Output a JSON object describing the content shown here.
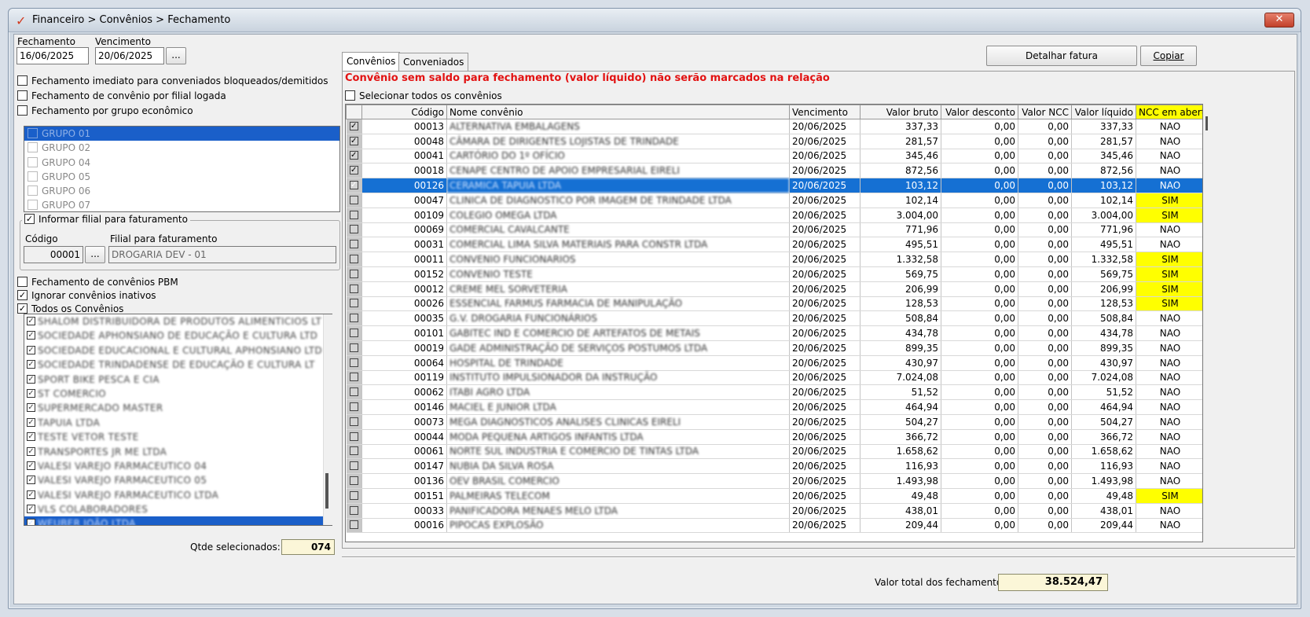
{
  "window": {
    "title": "Financeiro > Convênios > Fechamento",
    "close_label": "✕",
    "app_icon": "checkmark-logo-icon"
  },
  "left": {
    "fechamento_label": "Fechamento",
    "fechamento_value": "16/06/2025",
    "vencimento_label": "Vencimento",
    "vencimento_value": "20/06/2025",
    "date_btn": "...",
    "opt_imediato": "Fechamento imediato para conveniados bloqueados/demitidos",
    "opt_filial": "Fechamento de convênio por filial logada",
    "opt_grupo": "Fechamento por grupo econômico",
    "grupos": [
      "GRUPO 01",
      "GRUPO 02",
      "GRUPO 04",
      "GRUPO 05",
      "GRUPO 06",
      "GRUPO 07"
    ],
    "informar_filial": "Informar filial para faturamento",
    "codigo_label": "Código",
    "codigo_value": "00001",
    "filial_btn": "...",
    "filial_label": "Filial para faturamento",
    "filial_value": "DROGARIA DEV - 01",
    "opt_pbm": "Fechamento de convênios PBM",
    "opt_inativos": "Ignorar convênios inativos",
    "opt_todos": "Todos os Convênios",
    "convenios": [
      "SHALOM DISTRIBUIDORA DE PRODUTOS ALIMENTICIOS LT",
      "SOCIEDADE APHONSIANO DE EDUCAÇÃO E CULTURA LTD",
      "SOCIEDADE EDUCACIONAL E CULTURAL APHONSIANO LTD",
      "SOCIEDADE TRINDADENSE DE EDUCAÇÃO E CULTURA LT",
      "SPORT BIKE PESCA E CIA",
      "ST COMERCIO",
      "SUPERMERCADO MASTER",
      "TAPUIA LTDA",
      "TESTE VETOR TESTE",
      "TRANSPORTES JR ME LTDA",
      "VALESI VAREJO FARMACEUTICO 04",
      "VALESI VAREJO FARMACEUTICO 05",
      "VALESI VAREJO FARMACEUTICO LTDA",
      "VLS COLABORADORES",
      "WEUBER JOÃO LTDA"
    ],
    "qtde_label": "Qtde selecionados:",
    "qtde_value": "074"
  },
  "tabs": [
    "Convênios",
    "Conveniados"
  ],
  "toolbar": {
    "detalhar": "Detalhar fatura",
    "copiar": "Copiar"
  },
  "warning": "Convênio sem saldo para fechamento (valor líquido) não serão marcados na relação",
  "select_all": "Selecionar todos os convênios",
  "grid": {
    "columns": [
      "Código",
      "Nome convênio",
      "Vencimento",
      "Valor bruto",
      "Valor desconto",
      "Valor NCC",
      "Valor líquido",
      "NCC em aberto"
    ],
    "rows": [
      {
        "checked": true,
        "codigo": "00013",
        "nome": "ALTERNATIVA EMBALAGENS",
        "venc": "20/06/2025",
        "bruto": "337,33",
        "desc": "0,00",
        "ncc": "0,00",
        "liq": "337,33",
        "aberto": "NAO"
      },
      {
        "checked": true,
        "codigo": "00048",
        "nome": "CÂMARA DE DIRIGENTES LOJISTAS DE TRINDADE",
        "venc": "20/06/2025",
        "bruto": "281,57",
        "desc": "0,00",
        "ncc": "0,00",
        "liq": "281,57",
        "aberto": "NAO"
      },
      {
        "checked": true,
        "codigo": "00041",
        "nome": "CARTÓRIO DO 1º OFÍCIO",
        "venc": "20/06/2025",
        "bruto": "345,46",
        "desc": "0,00",
        "ncc": "0,00",
        "liq": "345,46",
        "aberto": "NAO"
      },
      {
        "checked": true,
        "codigo": "00018",
        "nome": "CENAPE CENTRO DE APOIO EMPRESARIAL EIRELI",
        "venc": "20/06/2025",
        "bruto": "872,56",
        "desc": "0,00",
        "ncc": "0,00",
        "liq": "872,56",
        "aberto": "NAO"
      },
      {
        "checked": true,
        "codigo": "00126",
        "nome": "CERAMICA TAPUIA LTDA",
        "venc": "20/06/2025",
        "bruto": "103,12",
        "desc": "0,00",
        "ncc": "0,00",
        "liq": "103,12",
        "aberto": "NAO",
        "sel": true
      },
      {
        "checked": false,
        "codigo": "00047",
        "nome": "CLINICA DE DIAGNOSTICO POR IMAGEM DE TRINDADE LTDA",
        "venc": "20/06/2025",
        "bruto": "102,14",
        "desc": "0,00",
        "ncc": "0,00",
        "liq": "102,14",
        "aberto": "SIM"
      },
      {
        "checked": false,
        "codigo": "00109",
        "nome": "COLEGIO OMEGA LTDA",
        "venc": "20/06/2025",
        "bruto": "3.004,00",
        "desc": "0,00",
        "ncc": "0,00",
        "liq": "3.004,00",
        "aberto": "SIM"
      },
      {
        "checked": false,
        "codigo": "00069",
        "nome": "COMERCIAL CAVALCANTE",
        "venc": "20/06/2025",
        "bruto": "771,96",
        "desc": "0,00",
        "ncc": "0,00",
        "liq": "771,96",
        "aberto": "NAO"
      },
      {
        "checked": false,
        "codigo": "00031",
        "nome": "COMERCIAL LIMA SILVA MATERIAIS PARA CONSTR LTDA",
        "venc": "20/06/2025",
        "bruto": "495,51",
        "desc": "0,00",
        "ncc": "0,00",
        "liq": "495,51",
        "aberto": "NAO"
      },
      {
        "checked": false,
        "codigo": "00011",
        "nome": "CONVENIO FUNCIONARIOS",
        "venc": "20/06/2025",
        "bruto": "1.332,58",
        "desc": "0,00",
        "ncc": "0,00",
        "liq": "1.332,58",
        "aberto": "SIM"
      },
      {
        "checked": false,
        "codigo": "00152",
        "nome": "CONVENIO TESTE",
        "venc": "20/06/2025",
        "bruto": "569,75",
        "desc": "0,00",
        "ncc": "0,00",
        "liq": "569,75",
        "aberto": "SIM"
      },
      {
        "checked": false,
        "codigo": "00012",
        "nome": "CREME MEL SORVETERIA",
        "venc": "20/06/2025",
        "bruto": "206,99",
        "desc": "0,00",
        "ncc": "0,00",
        "liq": "206,99",
        "aberto": "SIM"
      },
      {
        "checked": false,
        "codigo": "00026",
        "nome": "ESSENCIAL FARMUS FARMACIA DE MANIPULAÇÃO",
        "venc": "20/06/2025",
        "bruto": "128,53",
        "desc": "0,00",
        "ncc": "0,00",
        "liq": "128,53",
        "aberto": "SIM"
      },
      {
        "checked": false,
        "codigo": "00035",
        "nome": "G.V. DROGARIA FUNCIONÁRIOS",
        "venc": "20/06/2025",
        "bruto": "508,84",
        "desc": "0,00",
        "ncc": "0,00",
        "liq": "508,84",
        "aberto": "NAO"
      },
      {
        "checked": false,
        "codigo": "00101",
        "nome": "GABITEC IND E COMERCIO DE ARTEFATOS DE METAIS",
        "venc": "20/06/2025",
        "bruto": "434,78",
        "desc": "0,00",
        "ncc": "0,00",
        "liq": "434,78",
        "aberto": "NAO"
      },
      {
        "checked": false,
        "codigo": "00019",
        "nome": "GADE ADMINISTRAÇÃO DE SERVIÇOS POSTUMOS LTDA",
        "venc": "20/06/2025",
        "bruto": "899,35",
        "desc": "0,00",
        "ncc": "0,00",
        "liq": "899,35",
        "aberto": "NAO"
      },
      {
        "checked": false,
        "codigo": "00064",
        "nome": "HOSPITAL DE TRINDADE",
        "venc": "20/06/2025",
        "bruto": "430,97",
        "desc": "0,00",
        "ncc": "0,00",
        "liq": "430,97",
        "aberto": "NAO"
      },
      {
        "checked": false,
        "codigo": "00119",
        "nome": "INSTITUTO IMPULSIONADOR DA INSTRUÇÃO",
        "venc": "20/06/2025",
        "bruto": "7.024,08",
        "desc": "0,00",
        "ncc": "0,00",
        "liq": "7.024,08",
        "aberto": "NAO"
      },
      {
        "checked": false,
        "codigo": "00062",
        "nome": "ITABI AGRO LTDA",
        "venc": "20/06/2025",
        "bruto": "51,52",
        "desc": "0,00",
        "ncc": "0,00",
        "liq": "51,52",
        "aberto": "NAO"
      },
      {
        "checked": false,
        "codigo": "00146",
        "nome": "MACIEL E JUNIOR LTDA",
        "venc": "20/06/2025",
        "bruto": "464,94",
        "desc": "0,00",
        "ncc": "0,00",
        "liq": "464,94",
        "aberto": "NAO"
      },
      {
        "checked": false,
        "codigo": "00073",
        "nome": "MEGA DIAGNOSTICOS ANALISES CLINICAS EIRELI",
        "venc": "20/06/2025",
        "bruto": "504,27",
        "desc": "0,00",
        "ncc": "0,00",
        "liq": "504,27",
        "aberto": "NAO"
      },
      {
        "checked": false,
        "codigo": "00044",
        "nome": "MODA PEQUENA ARTIGOS INFANTIS LTDA",
        "venc": "20/06/2025",
        "bruto": "366,72",
        "desc": "0,00",
        "ncc": "0,00",
        "liq": "366,72",
        "aberto": "NAO"
      },
      {
        "checked": false,
        "codigo": "00061",
        "nome": "NORTE SUL INDUSTRIA E COMERCIO DE TINTAS LTDA",
        "venc": "20/06/2025",
        "bruto": "1.658,62",
        "desc": "0,00",
        "ncc": "0,00",
        "liq": "1.658,62",
        "aberto": "NAO"
      },
      {
        "checked": false,
        "codigo": "00147",
        "nome": "NUBIA DA SILVA ROSA",
        "venc": "20/06/2025",
        "bruto": "116,93",
        "desc": "0,00",
        "ncc": "0,00",
        "liq": "116,93",
        "aberto": "NAO"
      },
      {
        "checked": false,
        "codigo": "00136",
        "nome": "OEV BRASIL COMERCIO",
        "venc": "20/06/2025",
        "bruto": "1.493,98",
        "desc": "0,00",
        "ncc": "0,00",
        "liq": "1.493,98",
        "aberto": "NAO"
      },
      {
        "checked": false,
        "codigo": "00151",
        "nome": "PALMEIRAS TELECOM",
        "venc": "20/06/2025",
        "bruto": "49,48",
        "desc": "0,00",
        "ncc": "0,00",
        "liq": "49,48",
        "aberto": "SIM"
      },
      {
        "checked": false,
        "codigo": "00033",
        "nome": "PANIFICADORA MENAES MELO LTDA",
        "venc": "20/06/2025",
        "bruto": "438,01",
        "desc": "0,00",
        "ncc": "0,00",
        "liq": "438,01",
        "aberto": "NAO"
      },
      {
        "checked": false,
        "codigo": "00016",
        "nome": "PIPOCAS EXPLOSÃO",
        "venc": "20/06/2025",
        "bruto": "209,44",
        "desc": "0,00",
        "ncc": "0,00",
        "liq": "209,44",
        "aberto": "NAO"
      }
    ]
  },
  "total": {
    "label": "Valor total dos fechamento:",
    "value": "38.524,47"
  },
  "colors": {
    "selection": "#1570d3",
    "highlight": "#ffff00",
    "warning": "#e21212"
  }
}
